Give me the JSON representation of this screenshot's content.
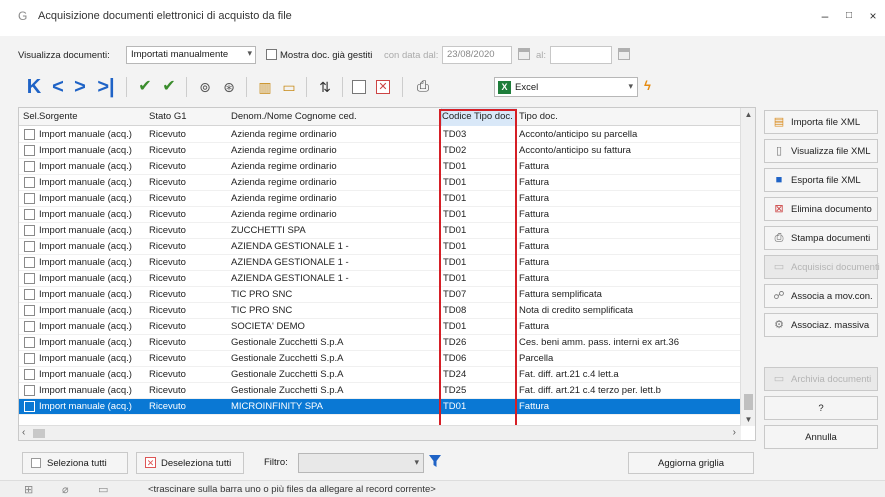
{
  "window": {
    "title": "Acquisizione documenti elettronici di acquisto da file",
    "app_icon": "G",
    "controls": {
      "minimize": "–",
      "maximize": "□",
      "close": "×"
    }
  },
  "filters": {
    "view_label": "Visualizza documenti:",
    "view_value": "Importati manualmente",
    "show_managed_label": "Mostra doc. già gestiti",
    "date_from_label": "con data dal:",
    "date_from_value": "23/08/2020",
    "date_to_label": "al:",
    "date_to_value": ""
  },
  "toolbar": {
    "nav_first": "K",
    "nav_prev": "<",
    "nav_next": ">",
    "nav_last": ">|",
    "export_format": "Excel",
    "excel_icon": "X"
  },
  "grid": {
    "columns": [
      "Sel.",
      "Sorgente",
      "Stato G1",
      "Denom./Nome Cognome ced.",
      "Codice Tipo doc.",
      "Tipo doc."
    ],
    "rows": [
      {
        "source": "Import manuale (acq.)",
        "status": "Ricevuto",
        "name": "Azienda regime ordinario",
        "code": "TD03",
        "type": "Acconto/anticipo su parcella"
      },
      {
        "source": "Import manuale (acq.)",
        "status": "Ricevuto",
        "name": "Azienda regime ordinario",
        "code": "TD02",
        "type": "Acconto/anticipo su fattura"
      },
      {
        "source": "Import manuale (acq.)",
        "status": "Ricevuto",
        "name": "Azienda regime ordinario",
        "code": "TD01",
        "type": "Fattura"
      },
      {
        "source": "Import manuale (acq.)",
        "status": "Ricevuto",
        "name": "Azienda regime ordinario",
        "code": "TD01",
        "type": "Fattura"
      },
      {
        "source": "Import manuale (acq.)",
        "status": "Ricevuto",
        "name": "Azienda regime ordinario",
        "code": "TD01",
        "type": "Fattura"
      },
      {
        "source": "Import manuale (acq.)",
        "status": "Ricevuto",
        "name": "Azienda regime ordinario",
        "code": "TD01",
        "type": "Fattura"
      },
      {
        "source": "Import manuale (acq.)",
        "status": "Ricevuto",
        "name": "ZUCCHETTI SPA",
        "code": "TD01",
        "type": "Fattura"
      },
      {
        "source": "Import manuale (acq.)",
        "status": "Ricevuto",
        "name": "AZIENDA GESTIONALE 1 -",
        "code": "TD01",
        "type": "Fattura"
      },
      {
        "source": "Import manuale (acq.)",
        "status": "Ricevuto",
        "name": "AZIENDA GESTIONALE 1 -",
        "code": "TD01",
        "type": "Fattura"
      },
      {
        "source": "Import manuale (acq.)",
        "status": "Ricevuto",
        "name": "AZIENDA GESTIONALE 1 -",
        "code": "TD01",
        "type": "Fattura"
      },
      {
        "source": "Import manuale (acq.)",
        "status": "Ricevuto",
        "name": "TIC PRO SNC",
        "code": "TD07",
        "type": "Fattura semplificata"
      },
      {
        "source": "Import manuale (acq.)",
        "status": "Ricevuto",
        "name": "TIC PRO SNC",
        "code": "TD08",
        "type": "Nota di credito semplificata"
      },
      {
        "source": "Import manuale (acq.)",
        "status": "Ricevuto",
        "name": "SOCIETA' DEMO",
        "code": "TD01",
        "type": "Fattura"
      },
      {
        "source": "Import manuale (acq.)",
        "status": "Ricevuto",
        "name": "Gestionale  Zucchetti S.p.A",
        "code": "TD26",
        "type": "Ces. beni amm. pass. interni ex art.36"
      },
      {
        "source": "Import manuale (acq.)",
        "status": "Ricevuto",
        "name": "Gestionale  Zucchetti S.p.A",
        "code": "TD06",
        "type": "Parcella"
      },
      {
        "source": "Import manuale (acq.)",
        "status": "Ricevuto",
        "name": "Gestionale  Zucchetti S.p.A",
        "code": "TD24",
        "type": "Fat. diff. art.21 c.4 lett.a"
      },
      {
        "source": "Import manuale (acq.)",
        "status": "Ricevuto",
        "name": "Gestionale  Zucchetti S.p.A",
        "code": "TD25",
        "type": "Fat. diff. art.21 c.4 terzo per. lett.b"
      },
      {
        "source": "Import manuale (acq.)",
        "status": "Ricevuto",
        "name": "MICROINFINITY SPA",
        "code": "TD01",
        "type": "Fattura"
      }
    ]
  },
  "actions": {
    "import_xml": "Importa file XML",
    "view_xml": "Visualizza file XML",
    "export_xml": "Esporta file XML",
    "delete_doc": "Elimina documento",
    "print_docs": "Stampa documenti",
    "acquire_docs": "Acquisisci documenti",
    "associate_mov": "Associa a mov.con.",
    "bulk_assoc": "Associaz. massiva",
    "archive_docs": "Archivia documenti",
    "help": "?",
    "cancel": "Annulla"
  },
  "bottom": {
    "select_all": "Seleziona tutti",
    "deselect_all": "Deseleziona tutti",
    "filter_label": "Filtro:",
    "refresh_grid": "Aggiorna griglia"
  },
  "status": {
    "hint": "<trascinare sulla barra uno o più files da allegare al record corrente>"
  },
  "colors": {
    "selection": "#0a78d4",
    "highlight_border": "#d51f26",
    "nav_blue": "#1f63c6"
  }
}
